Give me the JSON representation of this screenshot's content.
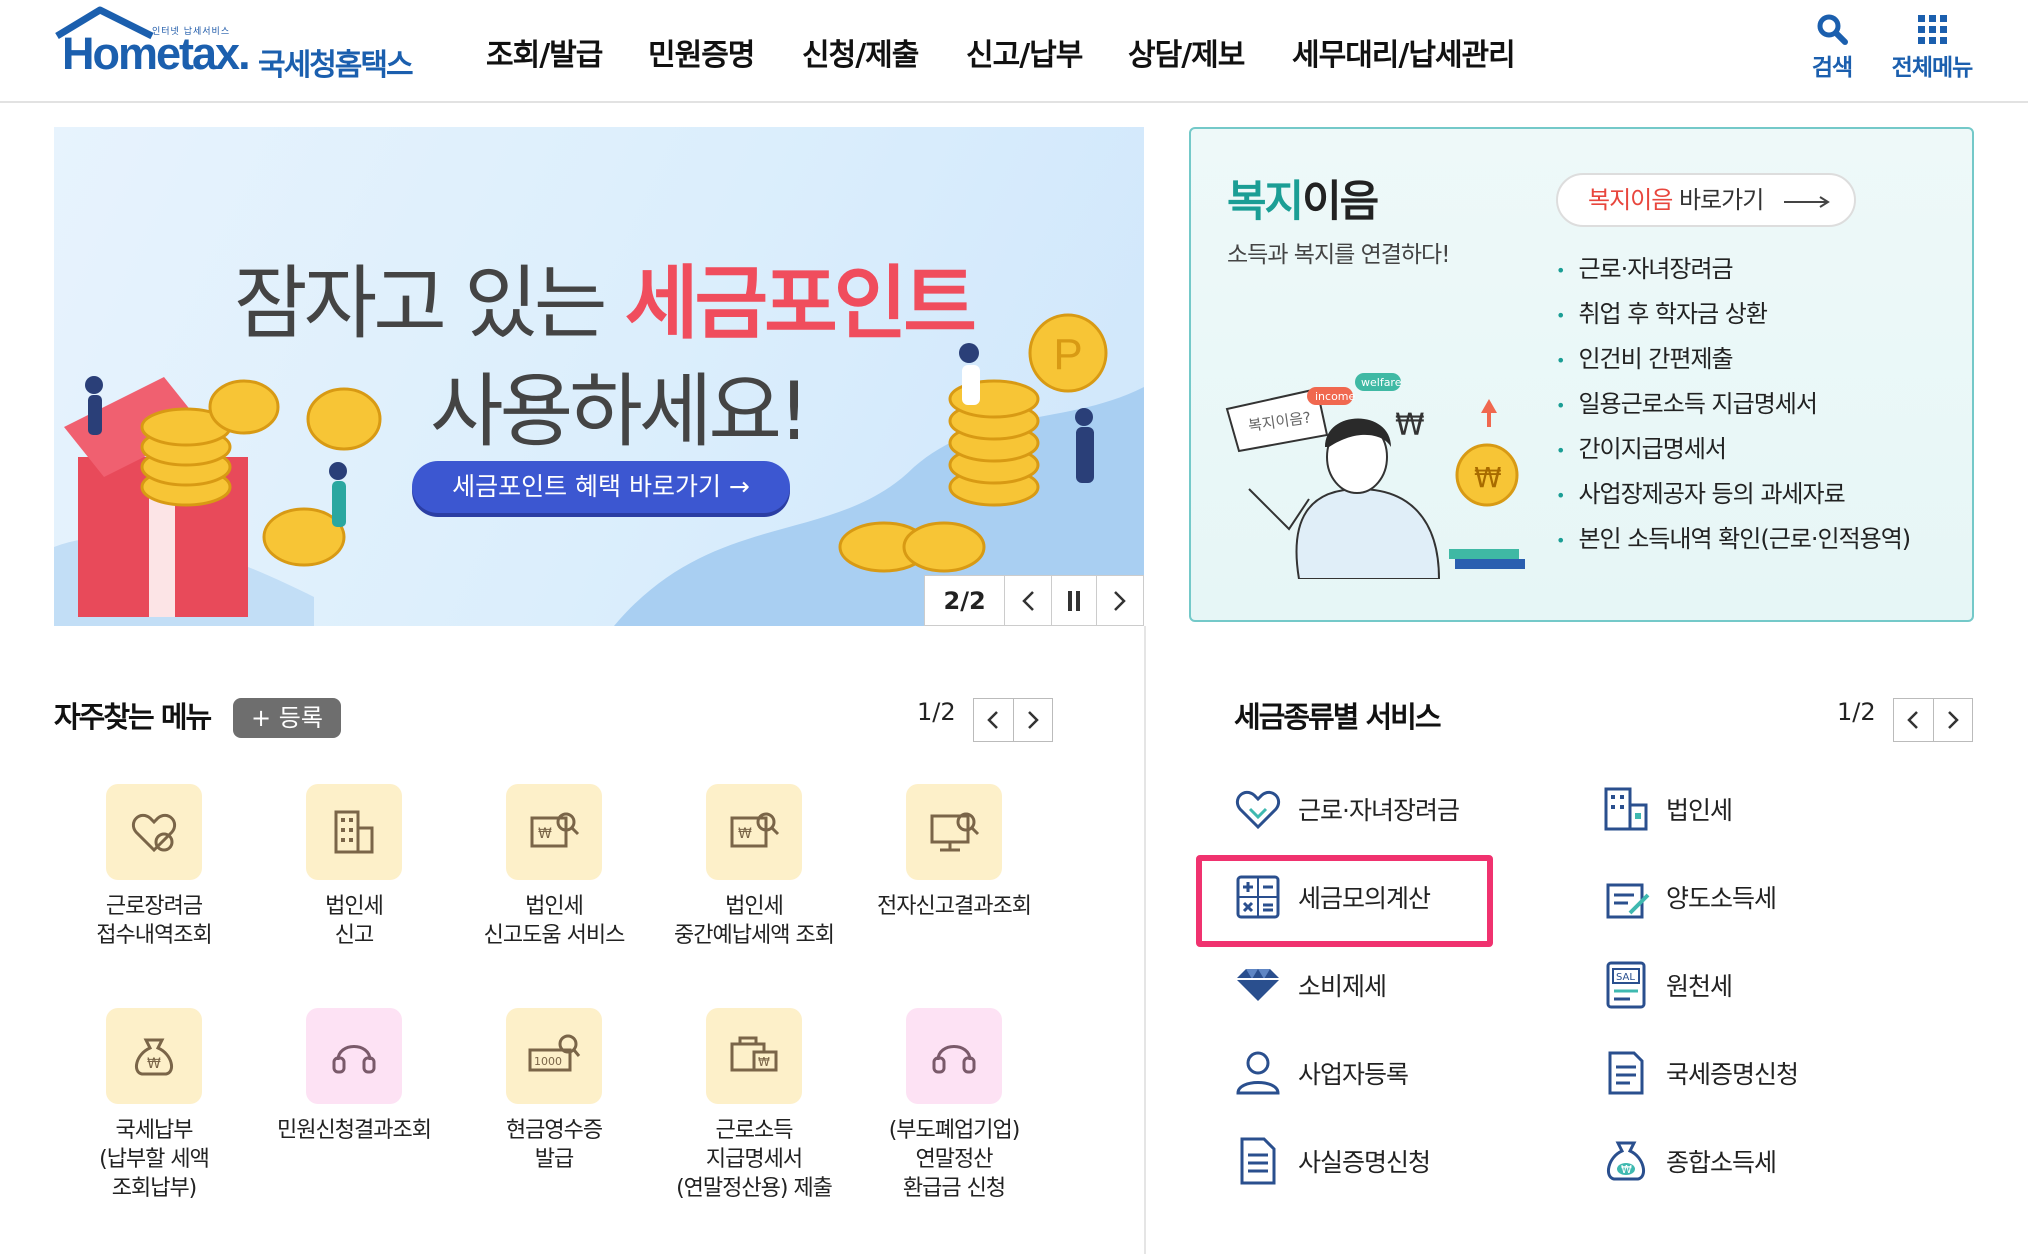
{
  "header": {
    "logo_tagline": "인터넷 납세서비스",
    "logo_text": "Hometax.",
    "logo_kr": "국세청홈택스",
    "nav": [
      "조회/발급",
      "민원증명",
      "신청/제출",
      "신고/납부",
      "상담/제보",
      "세무대리/납세관리"
    ],
    "search_label": "검색",
    "all_menu_label": "전체메뉴"
  },
  "banner": {
    "line1_plain": "잠자고 있는",
    "line1_highlight": "세금포인트",
    "line2": "사용하세요!",
    "button_label": "세금포인트 혜택 바로가기 →",
    "coin_text": "P",
    "pagination": "2/2",
    "prev_icon": "chevron-left-icon",
    "pause_icon": "pause-icon",
    "next_icon": "chevron-right-icon"
  },
  "welfare": {
    "title_accent": "복지",
    "title_rest": "이음",
    "subtitle": "소득과 복지를 연결하다!",
    "link_accent": "복지이음",
    "link_rest": "바로가기",
    "illustration_bubble": "복지이음?",
    "tag1": "income",
    "tag2": "welfare",
    "won_sign": "₩",
    "items": [
      "근로·자녀장려금",
      "취업 후 학자금 상환",
      "인건비 간편제출",
      "일용근로소득 지급명세서",
      "간이지급명세서",
      "사업장제공자 등의 과세자료",
      "본인 소득내역 확인(근로·인적용역)"
    ]
  },
  "favorites": {
    "title": "자주찾는 메뉴",
    "register_label": "+ 등록",
    "pagination": "1/2",
    "items": [
      {
        "label": "근로장려금\n접수내역조회",
        "icon": "heart-coin-icon",
        "tone": "yellow"
      },
      {
        "label": "법인세\n신고",
        "icon": "building-icon",
        "tone": "yellow"
      },
      {
        "label": "법인세\n신고도움 서비스",
        "icon": "document-search-icon",
        "tone": "yellow"
      },
      {
        "label": "법인세\n중간예납세액 조회",
        "icon": "document-search-icon",
        "tone": "yellow"
      },
      {
        "label": "전자신고결과조회",
        "icon": "monitor-search-icon",
        "tone": "yellow"
      },
      {
        "label": "국세납부\n(납부할 세액\n조회납부)",
        "icon": "money-bag-icon",
        "tone": "yellow"
      },
      {
        "label": "민원신청결과조회",
        "icon": "headset-icon",
        "tone": "pink"
      },
      {
        "label": "현금영수증\n발급",
        "icon": "receipt-search-icon",
        "tone": "yellow"
      },
      {
        "label": "근로소득\n지급명세서\n(연말정산용) 제출",
        "icon": "briefcase-won-icon",
        "tone": "yellow"
      },
      {
        "label": "(부도폐업기업)\n연말정산\n환급금 신청",
        "icon": "headset-icon",
        "tone": "pink"
      }
    ]
  },
  "tax_services": {
    "title": "세금종류별 서비스",
    "pagination": "1/2",
    "items": [
      {
        "label": "근로·자녀장려금",
        "icon": "heart-hand-icon"
      },
      {
        "label": "법인세",
        "icon": "building-icon"
      },
      {
        "label": "세금모의계산",
        "icon": "calculator-icon"
      },
      {
        "label": "양도소득세",
        "icon": "document-pen-icon"
      },
      {
        "label": "소비제세",
        "icon": "diamond-icon"
      },
      {
        "label": "원천세",
        "icon": "salary-slip-icon"
      },
      {
        "label": "사업자등록",
        "icon": "person-icon"
      },
      {
        "label": "국세증명신청",
        "icon": "certificate-icon"
      },
      {
        "label": "사실증명신청",
        "icon": "document-icon"
      },
      {
        "label": "종합소득세",
        "icon": "money-bag-icon"
      }
    ],
    "highlighted_item": "세금모의계산"
  },
  "colors": {
    "brand_blue": "#1b5fae",
    "banner_red": "#f04d5d",
    "banner_button": "#3c57d1",
    "welfare_teal": "#1b9e95",
    "highlight_pink": "#f0326f",
    "icon_yellow_bg": "#fdf0c9",
    "icon_pink_bg": "#fde2f4"
  }
}
